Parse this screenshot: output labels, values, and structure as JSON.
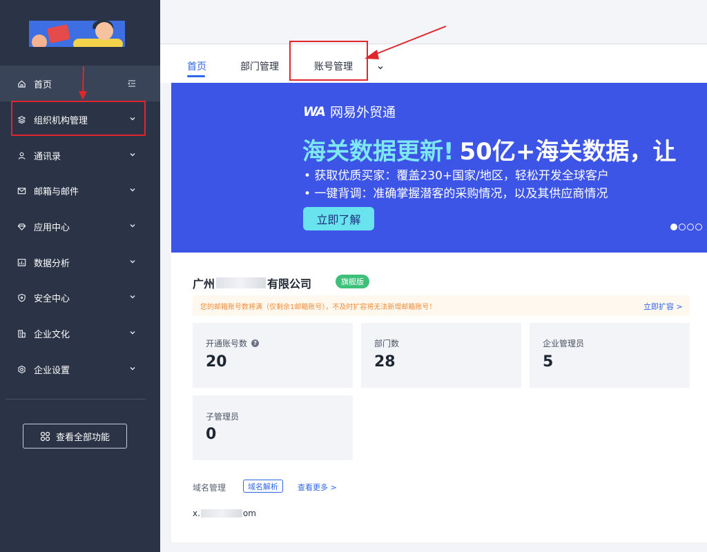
{
  "sidebar": {
    "items": [
      {
        "label": "首页",
        "icon": "home-icon"
      },
      {
        "label": "组织机构管理",
        "icon": "layers-icon"
      },
      {
        "label": "通讯录",
        "icon": "user-icon"
      },
      {
        "label": "邮箱与邮件",
        "icon": "mail-icon"
      },
      {
        "label": "应用中心",
        "icon": "diamond-icon"
      },
      {
        "label": "数据分析",
        "icon": "chart-icon"
      },
      {
        "label": "安全中心",
        "icon": "shield-icon"
      },
      {
        "label": "企业文化",
        "icon": "building-icon"
      },
      {
        "label": "企业设置",
        "icon": "settings-icon"
      }
    ],
    "all_features_label": "查看全部功能"
  },
  "tabs": [
    {
      "label": "首页",
      "active": true
    },
    {
      "label": "部门管理",
      "active": false
    },
    {
      "label": "账号管理",
      "active": false
    }
  ],
  "banner": {
    "brand": "网易外贸通",
    "brand_mark": "WA",
    "headline_highlight": "海关数据更新!",
    "headline_rest": "50亿+海关数据，让",
    "bullet1": "• 获取优质买家：覆盖230+国家/地区，轻松开发全球客户",
    "bullet2": "• 一键背调：准确掌握潜客的采购情况，以及其供应商情况",
    "cta": "立即了解",
    "background_color": "#3d55e6",
    "highlight_color": "#7ee8f2"
  },
  "company": {
    "name_prefix": "广州",
    "name_suffix": "有限公司",
    "badge": "旗舰版"
  },
  "notice": {
    "text": "您的邮箱账号数将满（仅剩余1邮箱账号），不及时扩容将无法新增邮箱账号！",
    "link": "立即扩容 >"
  },
  "stats": [
    {
      "label": "开通账号数",
      "value": "20"
    },
    {
      "label": "部门数",
      "value": "28"
    },
    {
      "label": "企业管理员",
      "value": "5"
    },
    {
      "label": "子管理员",
      "value": "0"
    }
  ],
  "domain": {
    "label": "域名管理",
    "tag": "域名解析",
    "more": "查看更多 >",
    "value_prefix": "x.",
    "value_suffix": "om"
  },
  "colors": {
    "sidebar_bg": "#2b3446",
    "accent": "#2e66e8",
    "annotation": "#e0262c"
  }
}
